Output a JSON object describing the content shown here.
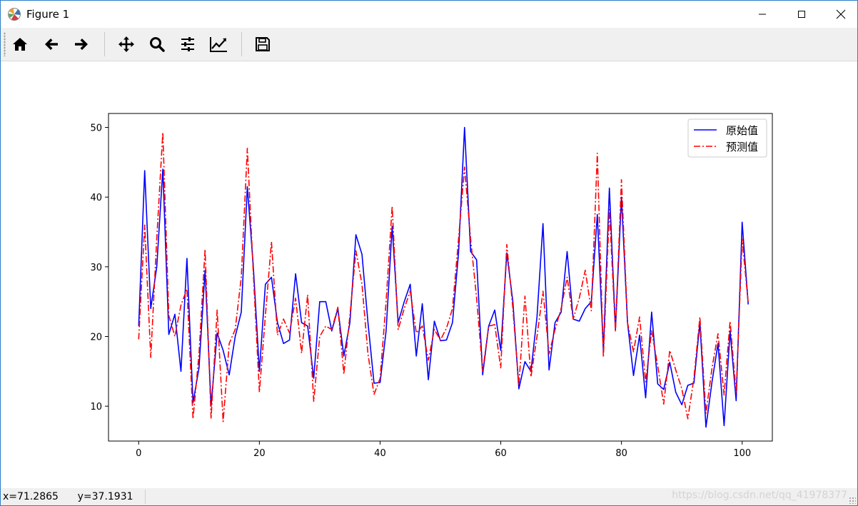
{
  "window": {
    "title": "Figure 1",
    "controls": {
      "minimize": "minimize",
      "maximize": "maximize",
      "close": "close"
    }
  },
  "toolbar": {
    "buttons": [
      "home-icon",
      "back-arrow-icon",
      "forward-arrow-icon",
      "pan-icon",
      "zoom-icon",
      "configure-subplots-icon",
      "edit-axis-icon",
      "save-icon"
    ]
  },
  "statusbar": {
    "coords": "x=71.2865      y=37.1931",
    "watermark": "https://blog.csdn.net/qq_41978377"
  },
  "colors": {
    "original": "#0000ff",
    "predicted": "#ff0000"
  },
  "chart_data": {
    "type": "line",
    "title": "",
    "xlabel": "",
    "ylabel": "",
    "xlim": [
      -5,
      105
    ],
    "ylim": [
      5,
      52
    ],
    "xticks": [
      0,
      20,
      40,
      60,
      80,
      100
    ],
    "yticks": [
      10,
      20,
      30,
      40,
      50
    ],
    "grid": false,
    "legend_position": "top-right",
    "x": [
      0,
      1,
      2,
      3,
      4,
      5,
      6,
      7,
      8,
      9,
      10,
      11,
      12,
      13,
      14,
      15,
      16,
      17,
      18,
      19,
      20,
      21,
      22,
      23,
      24,
      25,
      26,
      27,
      28,
      29,
      30,
      31,
      32,
      33,
      34,
      35,
      36,
      37,
      38,
      39,
      40,
      41,
      42,
      43,
      44,
      45,
      46,
      47,
      48,
      49,
      50,
      51,
      52,
      53,
      54,
      55,
      56,
      57,
      58,
      59,
      60,
      61,
      62,
      63,
      64,
      65,
      66,
      67,
      68,
      69,
      70,
      71,
      72,
      73,
      74,
      75,
      76,
      77,
      78,
      79,
      80,
      81,
      82,
      83,
      84,
      85,
      86,
      87,
      88,
      89,
      90,
      91,
      92,
      93,
      94,
      95,
      96,
      97,
      98,
      99,
      100,
      101
    ],
    "series": [
      {
        "name": "原始值",
        "style": "solid",
        "color": "#0000ff",
        "values": [
          21.5,
          43.8,
          24,
          30,
          44,
          20.3,
          23.2,
          15,
          31.2,
          10.5,
          15.5,
          29.5,
          10,
          20.5,
          18,
          14.5,
          20,
          23.5,
          41.5,
          30,
          15,
          27.5,
          28.5,
          22,
          19,
          19.5,
          29,
          22,
          21.5,
          14,
          25,
          25,
          20.8,
          24,
          17.2,
          22,
          34.6,
          31.8,
          22,
          13.3,
          13.4,
          20.8,
          35.8,
          22,
          25,
          27.5,
          17.2,
          24.7,
          13.8,
          22.2,
          19.4,
          19.5,
          22,
          32,
          50,
          32.2,
          31,
          14.5,
          21.5,
          23.8,
          18,
          32,
          25,
          12.5,
          16.4,
          15,
          22.8,
          36.2,
          15.2,
          22,
          23.5,
          32.2,
          22.5,
          22.2,
          24,
          25,
          37.5,
          18,
          41.3,
          21,
          40,
          22,
          14.4,
          20.2,
          11.2,
          23.5,
          13.2,
          12.4,
          16.3,
          12,
          10.2,
          13,
          13.3,
          22,
          7,
          13.5,
          19,
          7.2,
          20.8,
          10.8,
          36.4,
          24.6
        ]
      },
      {
        "name": "预测值",
        "style": "dashdot",
        "color": "#ff0000",
        "values": [
          19.6,
          36,
          17,
          34,
          49.3,
          23,
          20,
          24.5,
          26.8,
          8.2,
          17.5,
          32.5,
          8.2,
          23.8,
          7.8,
          19,
          21,
          28.5,
          47,
          29,
          12,
          23,
          33.6,
          20.2,
          22.5,
          20.5,
          25.5,
          17.6,
          26,
          10.7,
          20,
          21.5,
          21,
          24.2,
          14.6,
          23,
          32.3,
          27.5,
          17.5,
          11.7,
          14,
          25,
          38.7,
          21,
          24,
          26.5,
          20.5,
          21.5,
          16.6,
          21,
          19.5,
          21.2,
          24,
          34,
          44.3,
          34,
          25.5,
          15,
          21.5,
          21.7,
          15.5,
          33.2,
          24,
          13,
          25.8,
          14.2,
          20,
          26.5,
          17.5,
          21,
          24,
          28.5,
          22.5,
          25.5,
          29.5,
          23.7,
          46.3,
          17,
          38.2,
          20.8,
          42.5,
          22,
          17.8,
          22.8,
          13.5,
          20.8,
          15.8,
          10.3,
          18,
          15.2,
          12.5,
          8.2,
          14,
          22.8,
          9,
          15.5,
          20.4,
          11.6,
          22.2,
          11.8,
          34,
          24.8
        ]
      }
    ]
  }
}
